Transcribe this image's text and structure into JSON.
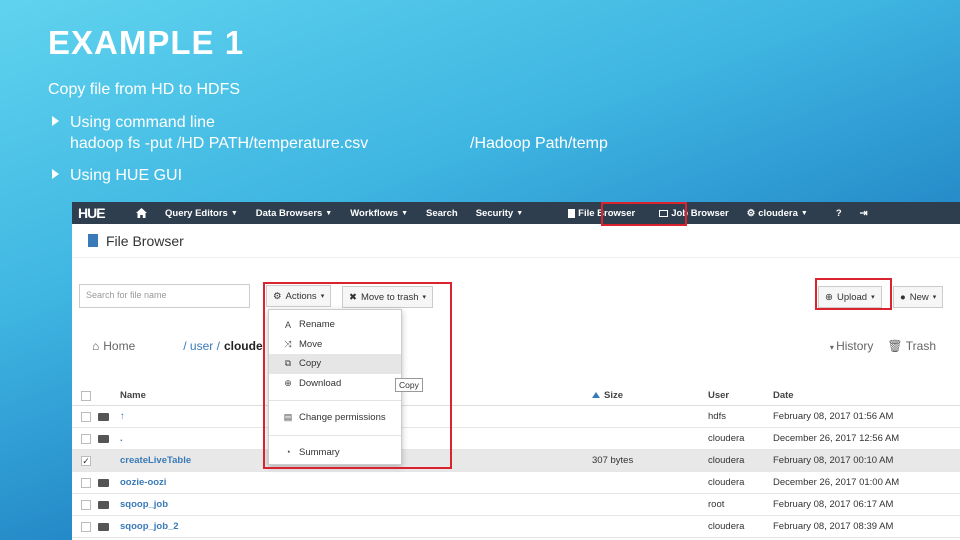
{
  "slide": {
    "title": "EXAMPLE 1",
    "subtitle": "Copy file from HD to HDFS",
    "bullets": [
      "Using command line",
      "Using HUE GUI"
    ],
    "command_part1": "hadoop fs -put /HD PATH/temperature.csv",
    "command_part2": "/Hadoop Path/temp"
  },
  "colors": {
    "highlight": "#d9232e",
    "navbar": "#2e3e4f",
    "link": "#3a7ab8"
  },
  "hue": {
    "logo": "HUE",
    "nav": [
      {
        "label": "Query Editors",
        "icon": "",
        "caret": true
      },
      {
        "label": "Data Browsers",
        "icon": "",
        "caret": true
      },
      {
        "label": "Workflows",
        "icon": "",
        "caret": true
      },
      {
        "label": "Search",
        "icon": "",
        "caret": false
      },
      {
        "label": "Security",
        "icon": "",
        "caret": true
      },
      {
        "label": "File Browser",
        "icon": "file-icon",
        "caret": false
      },
      {
        "label": "Job Browser",
        "icon": "list-icon",
        "caret": false
      },
      {
        "label": "cloudera",
        "icon": "gears-icon",
        "caret": true
      }
    ],
    "page_title": "File Browser",
    "search_placeholder": "Search for file name",
    "actions_label": "Actions",
    "trash_button_label": "Move to trash",
    "upload_label": "Upload",
    "new_label": "New",
    "breadcrumb": {
      "home": "Home",
      "user": "/ user /",
      "current": "cloude"
    },
    "history_label": "History",
    "trash_label": "Trash",
    "dropdown": [
      {
        "label": "Rename",
        "icon": "font-icon"
      },
      {
        "label": "Move",
        "icon": "random-icon"
      },
      {
        "label": "Copy",
        "icon": "copy-icon"
      },
      {
        "label": "Download",
        "icon": "download-icon"
      },
      {
        "label": "Change permissions",
        "icon": "list-alt-icon"
      },
      {
        "label": "Summary",
        "icon": "pie-chart-icon"
      }
    ],
    "tooltip": "Copy",
    "columns": {
      "name": "Name",
      "size": "Size",
      "user": "User",
      "date": "Date"
    },
    "rows": [
      {
        "name": "↑",
        "size": "",
        "user": "hdfs",
        "date": "February 08, 2017 01:56 AM",
        "checked": false
      },
      {
        "name": ".",
        "size": "",
        "user": "cloudera",
        "date": "December 26, 2017 12:56 AM",
        "checked": false
      },
      {
        "name": "createLiveTable",
        "size": "307 bytes",
        "user": "cloudera",
        "date": "February 08, 2017 00:10 AM",
        "checked": true
      },
      {
        "name": "oozie-oozi",
        "size": "",
        "user": "cloudera",
        "date": "December 26, 2017 01:00 AM",
        "checked": false
      },
      {
        "name": "sqoop_job",
        "size": "",
        "user": "root",
        "date": "February 08, 2017 06:17 AM",
        "checked": false
      },
      {
        "name": "sqoop_job_2",
        "size": "",
        "user": "cloudera",
        "date": "February 08, 2017 08:39 AM",
        "checked": false
      }
    ]
  }
}
